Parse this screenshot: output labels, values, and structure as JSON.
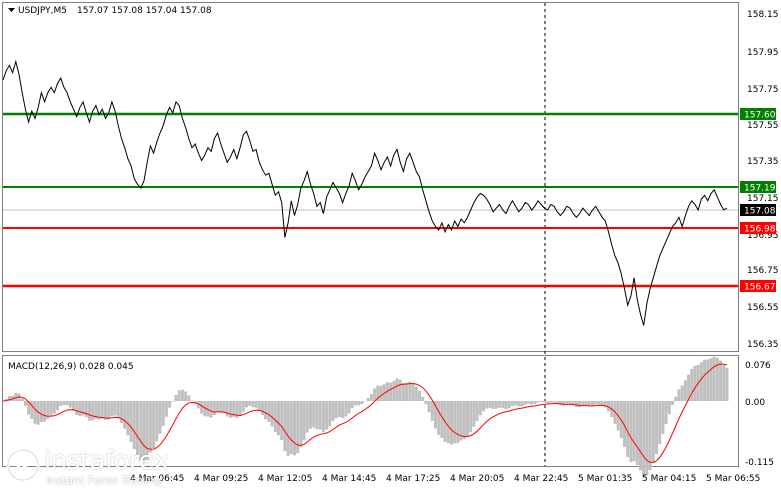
{
  "header": {
    "symbol": "USDJPY,M5",
    "ohlc": "157.07 157.08 157.04 157.08"
  },
  "macd": {
    "label": "MACD(12,26,9) 0.028 0.045",
    "axis_labels": [
      "0.076",
      "0.00",
      "-0.115"
    ]
  },
  "price_axis": {
    "labels": [
      "158.15",
      "157.95",
      "157.75",
      "157.55",
      "157.35",
      "157.15",
      "156.95",
      "156.75",
      "156.55",
      "156.35"
    ]
  },
  "levels": [
    {
      "label": "157.60",
      "color": "#008000"
    },
    {
      "label": "157.19",
      "color": "#008000"
    },
    {
      "label": "157.08",
      "color": "#000000"
    },
    {
      "label": "156.98",
      "color": "#ff0000"
    },
    {
      "label": "156.67",
      "color": "#ff0000"
    }
  ],
  "time_axis": {
    "labels": [
      "4 Mar 06:45",
      "4 Mar 09:25",
      "4 Mar 12:05",
      "4 Mar 14:45",
      "4 Mar 17:25",
      "4 Mar 20:05",
      "4 Mar 22:45",
      "5 Mar 01:35",
      "5 Mar 04:15",
      "5 Mar 06:55"
    ]
  },
  "logo": {
    "name": "instaforex",
    "tagline": "Instant Forex Trading"
  },
  "colors": {
    "price_line": "#000000",
    "support": "#ff0000",
    "resistance": "#008000",
    "macd_hist": "#c0c0c0",
    "macd_signal": "#ff0000"
  },
  "chart_data": {
    "type": "line",
    "ylim": [
      156.3,
      158.2
    ],
    "series": [
      {
        "values": [
          157.78,
          157.83,
          157.86,
          157.82,
          157.88,
          157.81,
          157.71,
          157.62,
          157.55,
          157.61,
          157.57,
          157.63,
          157.71,
          157.66,
          157.71,
          157.74,
          157.71,
          157.76,
          157.79,
          157.74,
          157.71,
          157.66,
          157.62,
          157.58,
          157.63,
          157.66,
          157.6,
          157.55,
          157.61,
          157.64,
          157.59,
          157.62,
          157.57,
          157.6,
          157.66,
          157.61,
          157.53,
          157.46,
          157.41,
          157.35,
          157.31,
          157.24,
          157.21,
          157.19,
          157.23,
          157.33,
          157.42,
          157.38,
          157.44,
          157.49,
          157.53,
          157.59,
          157.63,
          157.6,
          157.66,
          157.64,
          157.57,
          157.52,
          157.46,
          157.41,
          157.43,
          157.38,
          157.34,
          157.37,
          157.41,
          157.39,
          157.46,
          157.49,
          157.43,
          157.38,
          157.33,
          157.36,
          157.4,
          157.35,
          157.41,
          157.48,
          157.5,
          157.45,
          157.39,
          157.4,
          157.33,
          157.29,
          157.26,
          157.27,
          157.21,
          157.15,
          157.17,
          157.11,
          156.92,
          157.0,
          157.12,
          157.04,
          157.1,
          157.19,
          157.23,
          157.28,
          157.21,
          157.16,
          157.09,
          157.11,
          157.05,
          157.14,
          157.18,
          157.22,
          157.19,
          157.16,
          157.11,
          157.16,
          157.2,
          157.27,
          157.23,
          157.18,
          157.21,
          157.25,
          157.28,
          157.31,
          157.38,
          157.34,
          157.29,
          157.33,
          157.36,
          157.31,
          157.37,
          157.4,
          157.33,
          157.28,
          157.35,
          157.38,
          157.33,
          157.28,
          157.25,
          157.18,
          157.12,
          157.06,
          157.01,
          156.98,
          156.96,
          157.0,
          156.95,
          156.99,
          156.96,
          157.01,
          156.98,
          157.02,
          157.0,
          157.03,
          157.07,
          157.11,
          157.14,
          157.16,
          157.15,
          157.13,
          157.1,
          157.06,
          157.08,
          157.1,
          157.07,
          157.05,
          157.09,
          157.12,
          157.09,
          157.06,
          157.08,
          157.11,
          157.1,
          157.07,
          157.09,
          157.12,
          157.1,
          157.08,
          157.07,
          157.1,
          157.09,
          157.06,
          157.04,
          157.06,
          157.09,
          157.08,
          157.05,
          157.03,
          157.05,
          157.08,
          157.06,
          157.04,
          157.07,
          157.09,
          157.06,
          157.03,
          157.01,
          156.95,
          156.88,
          156.82,
          156.78,
          156.72,
          156.64,
          156.55,
          156.6,
          156.7,
          156.58,
          156.5,
          156.44,
          156.56,
          156.64,
          156.7,
          156.76,
          156.82,
          156.86,
          156.9,
          156.94,
          156.98,
          157.0,
          157.03,
          156.98,
          157.04,
          157.09,
          157.12,
          157.1,
          157.07,
          157.13,
          157.15,
          157.12,
          157.16,
          157.18,
          157.14,
          157.1,
          157.07,
          157.08
        ]
      }
    ]
  }
}
